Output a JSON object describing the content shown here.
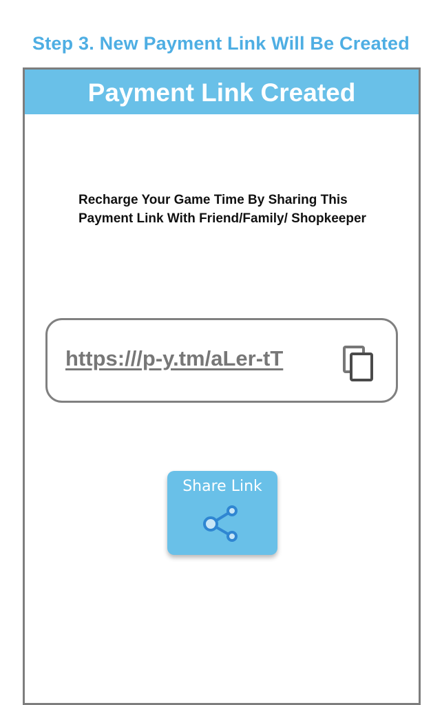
{
  "step_heading": "Step 3. New Payment Link Will Be Created",
  "screen": {
    "title": "Payment Link Created",
    "message": "Recharge Your Game Time By Sharing This Payment Link With Friend/Family/ Shopkeeper",
    "link": {
      "url": "https:///p-y.tm/aLer-tT",
      "copy_icon": "copy-icon"
    },
    "share_button": {
      "label": "Share Link",
      "icon": "share-icon"
    }
  },
  "colors": {
    "accent_blue": "#69c0e8",
    "heading_blue": "#4eaee3",
    "frame_gray": "#7d7d7d",
    "link_gray": "#777777"
  }
}
